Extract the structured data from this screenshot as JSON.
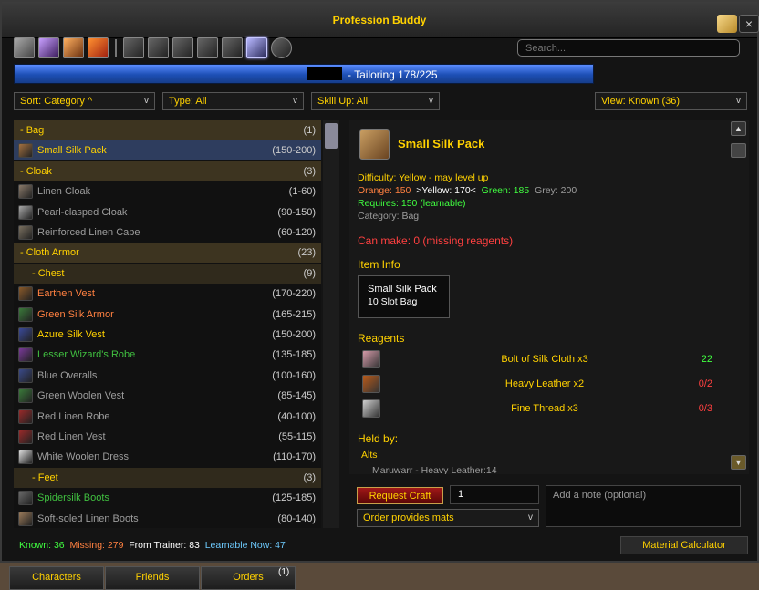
{
  "window": {
    "title": "Profession Buddy"
  },
  "search": {
    "placeholder": "Search..."
  },
  "skill": {
    "text": "- Tailoring 178/225"
  },
  "filters": {
    "sort": "Sort: Category ^",
    "type": "Type: All",
    "skill_up": "Skill Up: All",
    "view": "View: Known (36)"
  },
  "recipes": [
    {
      "kind": "header",
      "name": "- Bag",
      "range": "(1)"
    },
    {
      "kind": "item",
      "name": "Small Silk Pack",
      "range": "(150-200)",
      "color": "#ffd100",
      "selected": true,
      "icon": "#a47140"
    },
    {
      "kind": "header",
      "name": "- Cloak",
      "range": "(3)"
    },
    {
      "kind": "item",
      "name": "Linen Cloak",
      "range": "(1-60)",
      "color": "#9d9d9d",
      "icon": "#8a7a6a"
    },
    {
      "kind": "item",
      "name": "Pearl-clasped Cloak",
      "range": "(90-150)",
      "color": "#9d9d9d",
      "icon": "#a8a8a8"
    },
    {
      "kind": "item",
      "name": "Reinforced Linen Cape",
      "range": "(60-120)",
      "color": "#9d9d9d",
      "icon": "#7a7060"
    },
    {
      "kind": "header",
      "name": "- Cloth Armor",
      "range": "(23)"
    },
    {
      "kind": "sub",
      "name": "- Chest",
      "range": "(9)"
    },
    {
      "kind": "item",
      "name": "Earthen Vest",
      "range": "(170-220)",
      "color": "#ff8040",
      "icon": "#8a5a2a"
    },
    {
      "kind": "item",
      "name": "Green Silk Armor",
      "range": "(165-215)",
      "color": "#ff8040",
      "icon": "#3a7a3a"
    },
    {
      "kind": "item",
      "name": "Azure Silk Vest",
      "range": "(150-200)",
      "color": "#ffd100",
      "icon": "#3a4a9a"
    },
    {
      "kind": "item",
      "name": "Lesser Wizard's Robe",
      "range": "(135-185)",
      "color": "#40c040",
      "icon": "#7a3a9a"
    },
    {
      "kind": "item",
      "name": "Blue Overalls",
      "range": "(100-160)",
      "color": "#9d9d9d",
      "icon": "#3a4a8a"
    },
    {
      "kind": "item",
      "name": "Green Woolen Vest",
      "range": "(85-145)",
      "color": "#9d9d9d",
      "icon": "#3a7a3a"
    },
    {
      "kind": "item",
      "name": "Red Linen Robe",
      "range": "(40-100)",
      "color": "#9d9d9d",
      "icon": "#9a2a2a"
    },
    {
      "kind": "item",
      "name": "Red Linen Vest",
      "range": "(55-115)",
      "color": "#9d9d9d",
      "icon": "#9a2a2a"
    },
    {
      "kind": "item",
      "name": "White Woolen Dress",
      "range": "(110-170)",
      "color": "#9d9d9d",
      "icon": "#dddddd"
    },
    {
      "kind": "sub",
      "name": "- Feet",
      "range": "(3)"
    },
    {
      "kind": "item",
      "name": "Spidersilk Boots",
      "range": "(125-185)",
      "color": "#40c040",
      "icon": "#6a6a6a"
    },
    {
      "kind": "item",
      "name": "Soft-soled Linen Boots",
      "range": "(80-140)",
      "color": "#9d9d9d",
      "icon": "#9a7a5a"
    }
  ],
  "detail": {
    "name": "Small Silk Pack",
    "difficulty": "Difficulty: Yellow - may level up",
    "orange": "Orange: 150",
    "yellow": ">Yellow: 170<",
    "green": "Green: 185",
    "grey": "Grey: 200",
    "requires": "Requires: 150 (learnable)",
    "category": "Category: Bag",
    "can_make": "Can make: 0 (missing reagents)",
    "item_info_label": "Item Info",
    "item_info_name": "Small Silk Pack",
    "item_info_desc": "10 Slot Bag",
    "reagents_label": "Reagents",
    "reagents": [
      {
        "name": "Bolt of Silk Cloth x3",
        "count": "22",
        "count_color": "#40ff40",
        "icon": "#d49aa8"
      },
      {
        "name": "Heavy Leather x2",
        "count": "0/2",
        "count_color": "#ff4040",
        "icon": "#b85a1a"
      },
      {
        "name": "Fine Thread x3",
        "count": "0/3",
        "count_color": "#ff4040",
        "icon": "#cfcfcf"
      }
    ],
    "held_by_label": "Held by:",
    "alts_label": "Alts",
    "alts_entry": "Maruwarr - Heavy Leather:14"
  },
  "craft": {
    "request_label": "Request Craft",
    "quantity": "1",
    "mats_option": "Order provides mats",
    "note_placeholder": "Add a note (optional)"
  },
  "status": {
    "known": "Known: 36",
    "missing": "Missing: 279",
    "from_trainer": "From Trainer: 83",
    "learnable": "Learnable Now: 47"
  },
  "material_calculator": "Material Calculator",
  "tabs": [
    {
      "label": "Characters"
    },
    {
      "label": "Friends"
    },
    {
      "label": "Orders",
      "badge": "(1)"
    }
  ]
}
